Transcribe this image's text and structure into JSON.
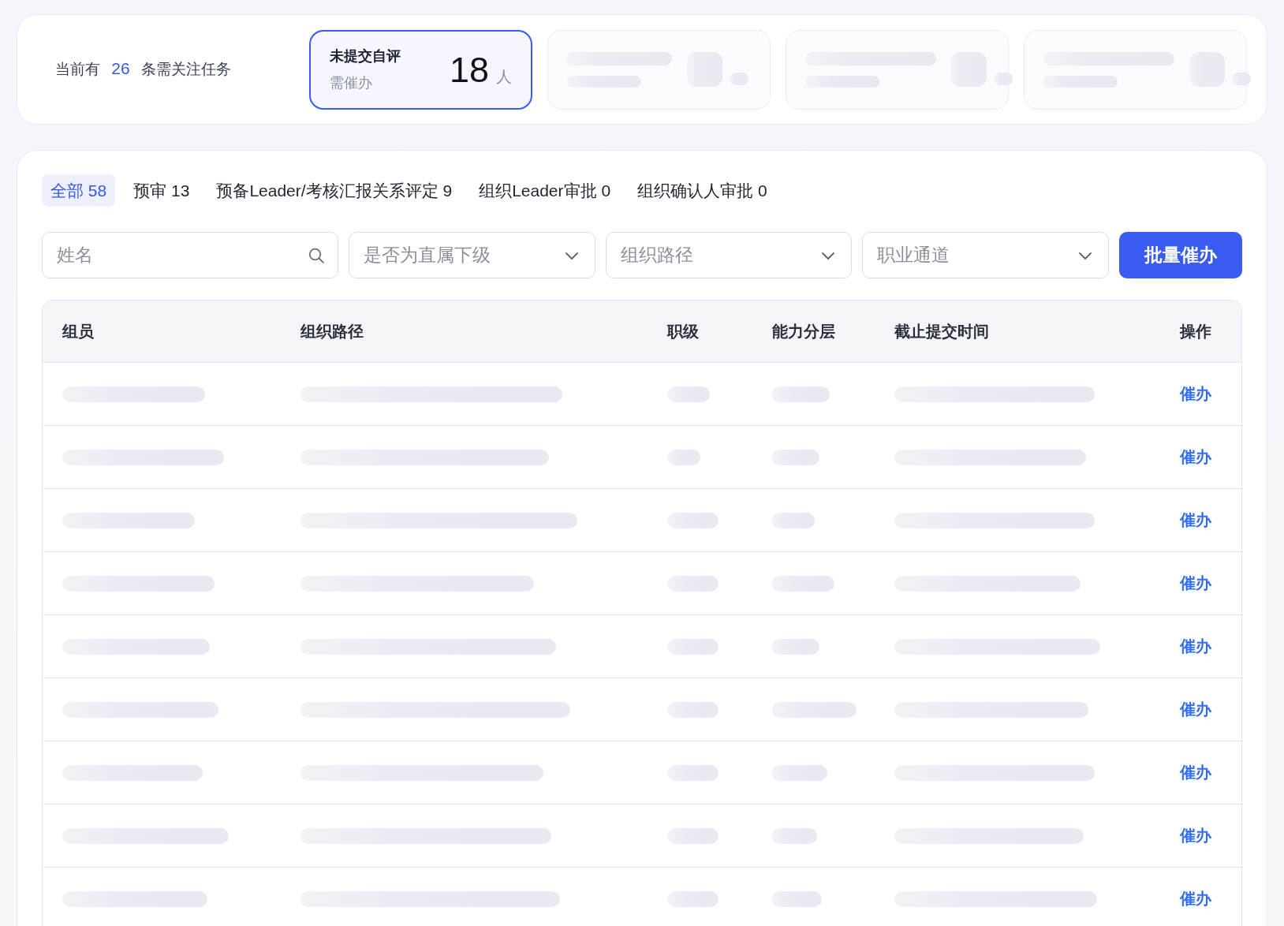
{
  "summary": {
    "text": "当前有 **26** 条需关注任务"
  },
  "stat_cards": [
    {
      "title": "未提交自评",
      "subtitle": "需催办",
      "count": "18",
      "unit": "人",
      "selected": true,
      "loading": false
    },
    {
      "selected": false,
      "loading": true
    },
    {
      "selected": false,
      "loading": true
    },
    {
      "selected": false,
      "loading": true
    }
  ],
  "tabs": [
    {
      "label": "全部 58",
      "selected": true
    },
    {
      "label": "预审 13",
      "selected": false
    },
    {
      "label": "预备Leader/考核汇报关系评定 9",
      "selected": false
    },
    {
      "label": "组织Leader审批 0",
      "selected": false
    },
    {
      "label": "组织确认人审批 0",
      "selected": false
    }
  ],
  "filters": [
    {
      "kind": "search",
      "placeholder": "姓名"
    },
    {
      "kind": "select",
      "placeholder": "是否为直属下级"
    },
    {
      "kind": "select",
      "placeholder": "组织路径"
    },
    {
      "kind": "select",
      "placeholder": "职业通道"
    }
  ],
  "batch_button": {
    "label": "批量催办"
  },
  "table": {
    "columns": [
      "组员",
      "组织路径",
      "职级",
      "能力分层",
      "截止提交时间",
      "操作"
    ],
    "rows": [
      {
        "loading": true,
        "action": "催办"
      },
      {
        "loading": true,
        "action": "催办"
      },
      {
        "loading": true,
        "action": "催办"
      },
      {
        "loading": true,
        "action": "催办"
      },
      {
        "loading": true,
        "action": "催办"
      },
      {
        "loading": true,
        "action": "催办"
      },
      {
        "loading": true,
        "action": "催办"
      },
      {
        "loading": true,
        "action": "催办"
      },
      {
        "loading": true,
        "action": "催办"
      }
    ]
  }
}
